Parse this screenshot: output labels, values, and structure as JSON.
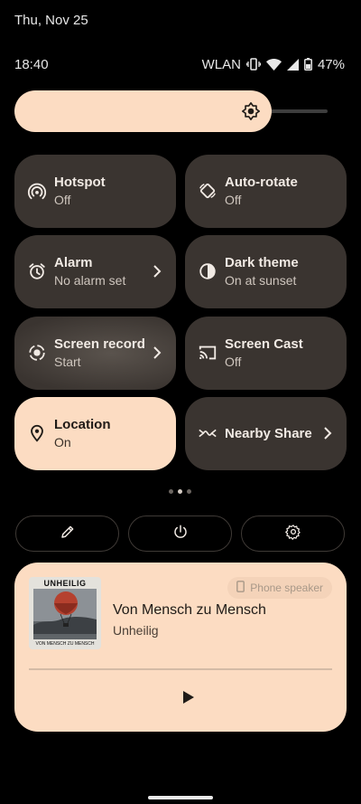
{
  "status": {
    "date": "Thu, Nov 25",
    "time": "18:40",
    "network_label": "WLAN",
    "battery": "47%",
    "icons": [
      "vibrate-icon",
      "wifi-icon",
      "signal-icon",
      "battery-icon"
    ]
  },
  "brightness": {
    "level": 0.82,
    "icon": "sun-icon"
  },
  "tiles": [
    {
      "label": "Hotspot",
      "sub": "Off",
      "icon": "hotspot-icon",
      "active": false
    },
    {
      "label": "Auto-rotate",
      "sub": "Off",
      "icon": "rotate-icon",
      "active": false
    },
    {
      "label": "Alarm",
      "sub": "No alarm set",
      "icon": "alarm-icon",
      "active": false,
      "chevron": true
    },
    {
      "label": "Dark theme",
      "sub": "On at sunset",
      "icon": "contrast-icon",
      "active": false
    },
    {
      "label": "Screen record",
      "sub": "Start",
      "icon": "record-icon",
      "active": false,
      "chevron": true
    },
    {
      "label": "Screen Cast",
      "sub": "Off",
      "icon": "cast-icon",
      "active": false
    },
    {
      "label": "Location",
      "sub": "On",
      "icon": "location-icon",
      "active": true
    },
    {
      "label": "Nearby Share",
      "icon": "nearby-share-icon",
      "active": false,
      "chevron": true
    }
  ],
  "pager": {
    "pages": 3,
    "current": 2
  },
  "actions": [
    "edit-icon",
    "power-icon",
    "settings-icon"
  ],
  "media": {
    "album_art_text_top": "UNHEILIG",
    "album_art_text_bottom": "VON MENSCH ZU MENSCH",
    "title": "Von Mensch zu Mensch",
    "artist": "Unheilig",
    "output": "Phone speaker",
    "progress": 0
  },
  "colors": {
    "accent": "#fcdcc2",
    "tile": "#3a3430",
    "background": "#000000"
  }
}
